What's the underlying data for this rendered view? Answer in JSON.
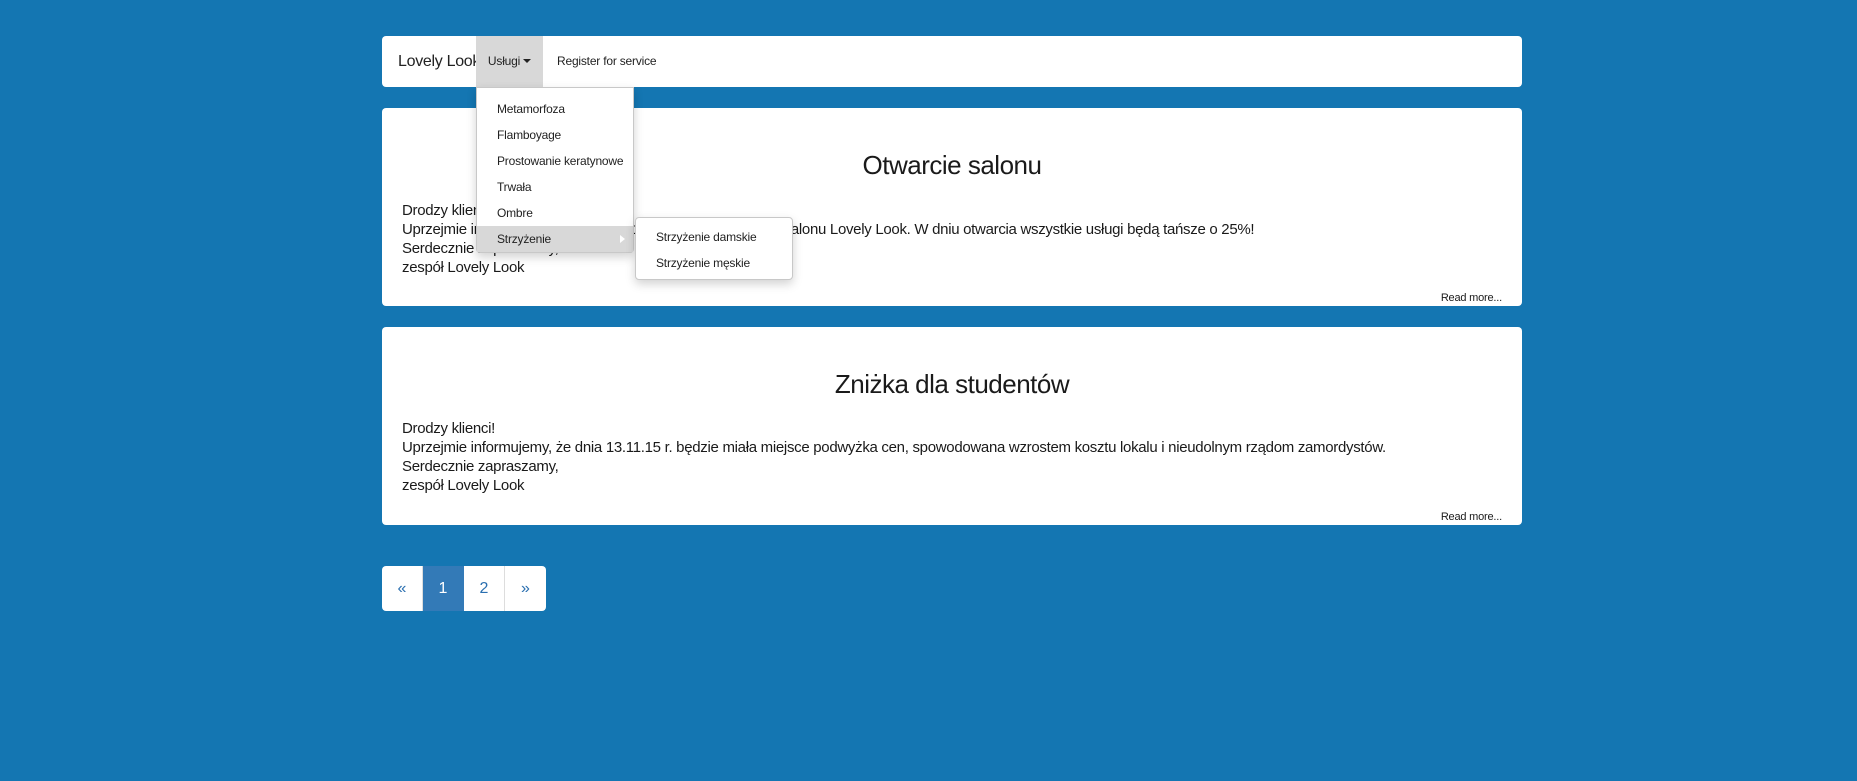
{
  "navbar": {
    "brand": "Lovely Look",
    "menu_uslugi": "Usługi",
    "menu_register": "Register for service"
  },
  "dropdown": {
    "items": [
      {
        "label": "Metamorfoza"
      },
      {
        "label": "Flamboyage"
      },
      {
        "label": "Prostowanie keratynowe"
      },
      {
        "label": "Trwała"
      },
      {
        "label": "Ombre"
      },
      {
        "label": "Strzyżenie"
      }
    ],
    "submenu": [
      {
        "label": "Strzyżenie damskie"
      },
      {
        "label": "Strzyżenie męskie"
      }
    ]
  },
  "posts": [
    {
      "title": "Otwarcie salonu",
      "lines": [
        "Drodzy klienci!",
        "Uprzejmie informujemy, że dnia 13.11.15 r. nastąpi otwarcie salonu Lovely Look. W dniu otwarcia wszystkie usługi będą tańsze o 25%!",
        "Serdecznie zapraszamy,",
        "zespół Lovely Look"
      ],
      "read_more": "Read more..."
    },
    {
      "title": "Zniżka dla studentów",
      "lines": [
        "Drodzy klienci!",
        "Uprzejmie informujemy, że dnia 13.11.15 r. będzie miała miejsce podwyżka cen, spowodowana wzrostem kosztu lokalu i nieudolnym rządom zamordystów.",
        "Serdecznie zapraszamy,",
        "zespół Lovely Look"
      ],
      "read_more": "Read more..."
    }
  ],
  "pagination": {
    "prev": "«",
    "pages": [
      "1",
      "2"
    ],
    "active_page": "1",
    "next": "»"
  },
  "colors": {
    "background": "#1476b2",
    "active_page": "#337ab7",
    "menu_highlight": "#d8d8d8"
  }
}
